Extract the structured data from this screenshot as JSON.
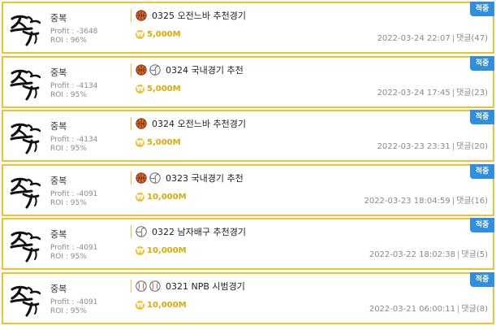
{
  "posts": [
    {
      "author": "중복",
      "profit": "Profit : -3648",
      "roi": "ROI : 96%",
      "sports": [
        "basketball"
      ],
      "title": "0325 오전느바 추천경기",
      "price": "5,000M",
      "date": "2022-03-24 22:07",
      "comments": "댓글(47)",
      "badge": "적중"
    },
    {
      "author": "중복",
      "profit": "Profit : -4134",
      "roi": "ROI : 95%",
      "sports": [
        "basketball",
        "volleyball"
      ],
      "title": "0324 국내경기 추천",
      "price": "5,000M",
      "date": "2022-03-24 17:45",
      "comments": "댓글(23)",
      "badge": "적중"
    },
    {
      "author": "중복",
      "profit": "Profit : -4134",
      "roi": "ROI : 95%",
      "sports": [
        "basketball"
      ],
      "title": "0324 오전느바 추천경기",
      "price": "5,000M",
      "date": "2022-03-23 23:31",
      "comments": "댓글(20)",
      "badge": "적중"
    },
    {
      "author": "중복",
      "profit": "Profit : -4091",
      "roi": "ROI : 95%",
      "sports": [
        "basketball",
        "volleyball"
      ],
      "title": "0323 국내경기 추천",
      "price": "10,000M",
      "date": "2022-03-23 18:04:59",
      "comments": "댓글(16)",
      "badge": "적중"
    },
    {
      "author": "중복",
      "profit": "Profit : -4091",
      "roi": "ROI : 95%",
      "sports": [
        "volleyball"
      ],
      "title": "0322 남자배구 추천경기",
      "price": "10,000M",
      "date": "2022-03-22 18:02:38",
      "comments": "댓글(5)",
      "badge": "적중"
    },
    {
      "author": "중복",
      "profit": "Profit : -4091",
      "roi": "ROI : 95%",
      "sports": [
        "baseball",
        "baseball"
      ],
      "title": "0321 NPB 시범경기",
      "price": "10,000M",
      "date": "2022-03-21 06:00:11",
      "comments": "댓글(8)",
      "badge": "적중"
    }
  ],
  "colors": {
    "border": "#f5c030",
    "badge": "#2e8fe0",
    "price": "#e0a800"
  },
  "icons": {
    "coin": "coin-icon",
    "basketball": "basketball-icon",
    "volleyball": "volleyball-icon",
    "baseball": "baseball-icon"
  }
}
